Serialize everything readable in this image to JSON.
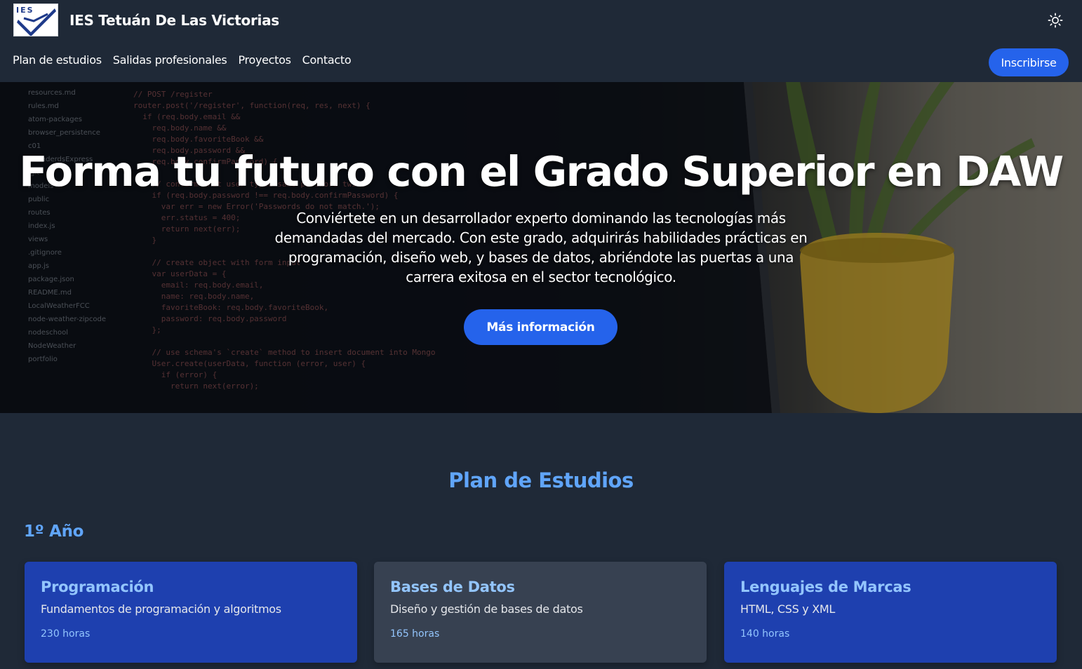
{
  "header": {
    "brand_name": "IES Tetuán De Las Victorias",
    "logo_text": "IES",
    "nav": [
      "Plan de estudios",
      "Salidas profesionales",
      "Proyectos",
      "Contacto"
    ],
    "enroll_label": "Inscribirse",
    "theme_icon": "sun-icon"
  },
  "hero": {
    "title": "Forma tu futuro con el Grado Superior en DAW",
    "subtitle": "Conviértete en un desarrollador experto dominando las tecnologías más demandadas del mercado. Con este grado, adquirirás habilidades prácticas en programación, diseño web, y bases de datos, abriéndote las puertas a una carrera exitosa en el sector tecnológico.",
    "button_label": "Más información"
  },
  "plan": {
    "title": "Plan de Estudios",
    "year_title": "1º Año",
    "courses": [
      {
        "title": "Programación",
        "description": "Fundamentos de programación y algoritmos",
        "hours": "230 horas"
      },
      {
        "title": "Bases de Datos",
        "description": "Diseño y gestión de bases de datos",
        "hours": "165 horas"
      },
      {
        "title": "Lenguajes de Marcas",
        "description": "HTML, CSS y XML",
        "hours": "140 horas"
      }
    ]
  },
  "colors": {
    "background": "#1f2937",
    "accent": "#2563eb",
    "heading": "#60a5fa",
    "card_blue": "#1e40af",
    "card_gray": "#374151"
  }
}
